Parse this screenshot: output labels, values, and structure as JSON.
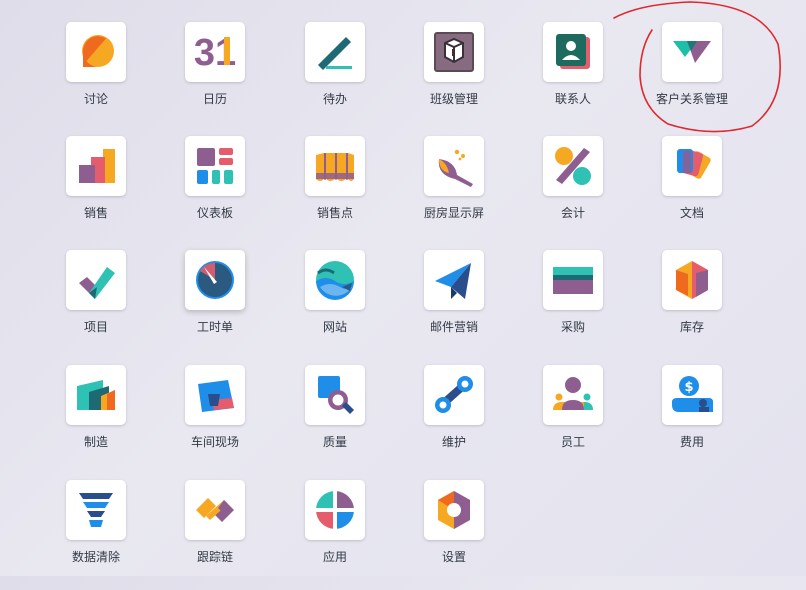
{
  "apps": [
    {
      "label": "讨论",
      "icon": "discuss-icon"
    },
    {
      "label": "日历",
      "icon": "calendar-icon",
      "icon_text": "31"
    },
    {
      "label": "待办",
      "icon": "todo-icon"
    },
    {
      "label": "班级管理",
      "icon": "class-management-icon"
    },
    {
      "label": "联系人",
      "icon": "contacts-icon"
    },
    {
      "label": "客户关系管理",
      "icon": "crm-icon"
    },
    {
      "label": "销售",
      "icon": "sales-icon"
    },
    {
      "label": "仪表板",
      "icon": "dashboard-icon"
    },
    {
      "label": "销售点",
      "icon": "point-of-sale-icon"
    },
    {
      "label": "厨房显示屏",
      "icon": "kitchen-display-icon"
    },
    {
      "label": "会计",
      "icon": "accounting-icon"
    },
    {
      "label": "文档",
      "icon": "documents-icon"
    },
    {
      "label": "项目",
      "icon": "project-icon"
    },
    {
      "label": "工时单",
      "icon": "timesheet-icon"
    },
    {
      "label": "网站",
      "icon": "website-icon"
    },
    {
      "label": "邮件营销",
      "icon": "email-marketing-icon"
    },
    {
      "label": "采购",
      "icon": "purchase-icon"
    },
    {
      "label": "库存",
      "icon": "inventory-icon"
    },
    {
      "label": "制造",
      "icon": "manufacturing-icon"
    },
    {
      "label": "车间现场",
      "icon": "shop-floor-icon"
    },
    {
      "label": "质量",
      "icon": "quality-icon"
    },
    {
      "label": "维护",
      "icon": "maintenance-icon"
    },
    {
      "label": "员工",
      "icon": "employees-icon"
    },
    {
      "label": "费用",
      "icon": "expenses-icon"
    },
    {
      "label": "数据清除",
      "icon": "data-cleaning-icon"
    },
    {
      "label": "跟踪链",
      "icon": "link-tracker-icon"
    },
    {
      "label": "应用",
      "icon": "apps-icon"
    },
    {
      "label": "设置",
      "icon": "settings-icon"
    }
  ],
  "colors": {
    "background": "#e5e4ee",
    "tile": "#ffffff",
    "label_text": "#333a45",
    "annotation_circle": "#e0282e"
  }
}
